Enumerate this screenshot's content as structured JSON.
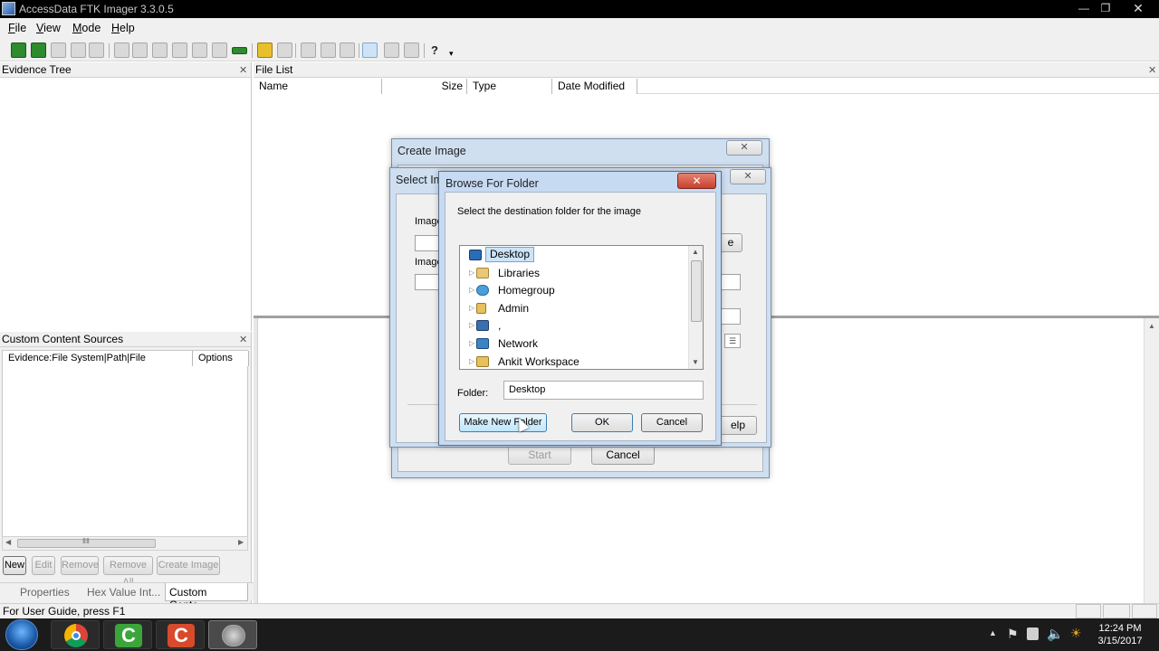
{
  "window": {
    "title": "AccessData FTK Imager 3.3.0.5"
  },
  "menu": [
    "File",
    "View",
    "Mode",
    "Help"
  ],
  "panes": {
    "evidence_tree": {
      "title": "Evidence Tree"
    },
    "file_list": {
      "title": "File List",
      "columns": [
        "Name",
        "Size",
        "Type",
        "Date Modified"
      ]
    },
    "custom_sources": {
      "title": "Custom Content Sources",
      "columns": [
        "Evidence:File System|Path|File",
        "Options"
      ],
      "buttons": [
        "New",
        "Edit",
        "Remove",
        "Remove All",
        "Create Image"
      ],
      "scroll_grip": "ⅡⅡ"
    }
  },
  "bottom_tabs": [
    "Properties",
    "Hex Value Int...",
    "Custom Conte..."
  ],
  "status_bar": "For User Guide, press F1",
  "dialogs": {
    "create_image": {
      "title": "Create Image",
      "start_label": "Start",
      "cancel_label": "Cancel"
    },
    "select_image": {
      "title": "Select Ima",
      "label1": "Image",
      "label2": "Image",
      "help_label": "elp",
      "browse_fragment": "e"
    },
    "browse_folder": {
      "title": "Browse For Folder",
      "instruction": "Select the destination folder for the image",
      "tree_items": [
        {
          "label": "Desktop",
          "icon": "desktop-icon",
          "selected": true
        },
        {
          "label": "Libraries",
          "icon": "libraries-icon"
        },
        {
          "label": "Homegroup",
          "icon": "homegroup-icon"
        },
        {
          "label": "Admin",
          "icon": "user-folder-icon"
        },
        {
          "label": ",",
          "icon": "computer-icon"
        },
        {
          "label": "Network",
          "icon": "network-icon"
        },
        {
          "label": "Ankit Workspace",
          "icon": "folder-icon"
        }
      ],
      "folder_label": "Folder:",
      "folder_value": "Desktop",
      "buttons": {
        "new_folder": "Make New Folder",
        "ok": "OK",
        "cancel": "Cancel"
      }
    }
  },
  "taskbar": {
    "time": "12:24 PM",
    "date": "3/15/2017"
  },
  "colors": {
    "selection": "#cce4f7",
    "taskbar": "#1b1b1b",
    "close_red": "#c9402e"
  }
}
